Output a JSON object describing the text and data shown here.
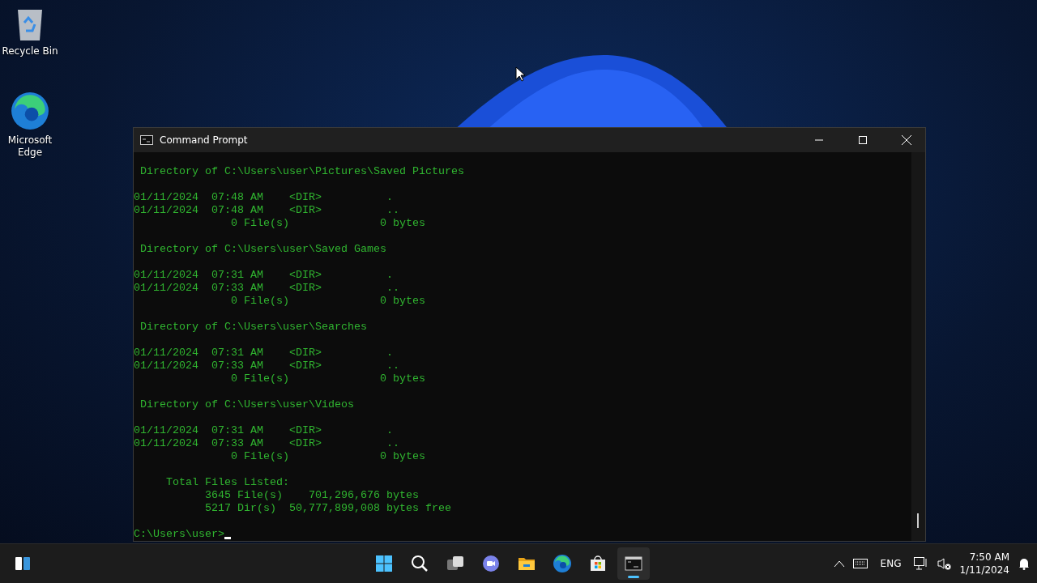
{
  "desktop_icons": [
    {
      "kind": "recycle-bin",
      "label": "Recycle Bin"
    },
    {
      "kind": "edge",
      "label": "Microsoft Edge"
    }
  ],
  "window": {
    "title": "Command Prompt",
    "console": {
      "listings": [
        {
          "heading": "Directory of C:\\Users\\user\\Pictures\\Saved Pictures",
          "rows": [
            "01/11/2024  07:48 AM    <DIR>          .",
            "01/11/2024  07:48 AM    <DIR>          ..",
            "               0 File(s)              0 bytes"
          ]
        },
        {
          "heading": "Directory of C:\\Users\\user\\Saved Games",
          "rows": [
            "01/11/2024  07:31 AM    <DIR>          .",
            "01/11/2024  07:33 AM    <DIR>          ..",
            "               0 File(s)              0 bytes"
          ]
        },
        {
          "heading": "Directory of C:\\Users\\user\\Searches",
          "rows": [
            "01/11/2024  07:31 AM    <DIR>          .",
            "01/11/2024  07:33 AM    <DIR>          ..",
            "               0 File(s)              0 bytes"
          ]
        },
        {
          "heading": "Directory of C:\\Users\\user\\Videos",
          "rows": [
            "01/11/2024  07:31 AM    <DIR>          .",
            "01/11/2024  07:33 AM    <DIR>          ..",
            "               0 File(s)              0 bytes"
          ]
        }
      ],
      "totals": [
        "     Total Files Listed:",
        "           3645 File(s)    701,296,676 bytes",
        "           5217 Dir(s)  50,777,899,008 bytes free"
      ],
      "prompt": "C:\\Users\\user>"
    }
  },
  "taskbar": {
    "apps": [
      {
        "kind": "start",
        "selected": false
      },
      {
        "kind": "search",
        "selected": false
      },
      {
        "kind": "task-view",
        "selected": false
      },
      {
        "kind": "chat",
        "selected": false
      },
      {
        "kind": "explorer",
        "selected": false
      },
      {
        "kind": "edge",
        "selected": false
      },
      {
        "kind": "store",
        "selected": false
      },
      {
        "kind": "terminal",
        "selected": true
      }
    ],
    "language": "ENG",
    "time": "7:50 AM",
    "date": "1/11/2024"
  }
}
